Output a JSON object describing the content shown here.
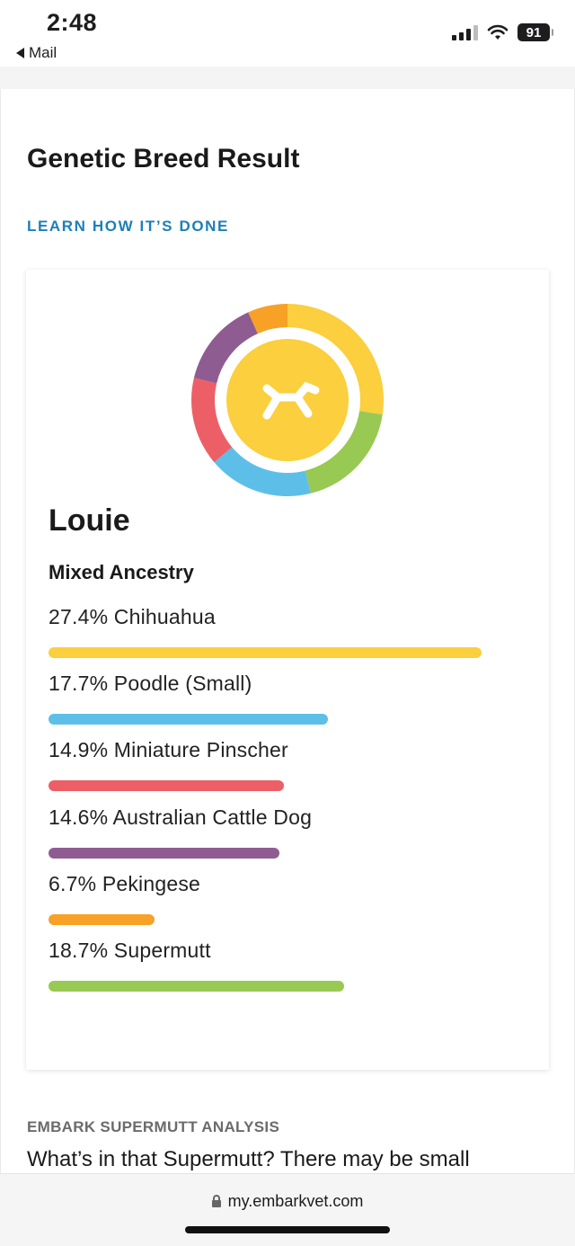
{
  "status": {
    "time": "2:48",
    "back_app": "Mail",
    "battery": "91"
  },
  "page": {
    "title": "Genetic Breed Result",
    "learn_link": "LEARN HOW IT’S DONE"
  },
  "result": {
    "dog_name": "Louie",
    "ancestry_label": "Mixed Ancestry",
    "logo_icon": "embark-dog-logo-icon",
    "breeds": [
      {
        "label": "27.4% Chihuahua",
        "percent": 27.4,
        "color": "#fbcf3d"
      },
      {
        "label": "17.7% Poodle (Small)",
        "percent": 17.7,
        "color": "#5dbfe8"
      },
      {
        "label": "14.9% Miniature Pinscher",
        "percent": 14.9,
        "color": "#ed5f66"
      },
      {
        "label": "14.6% Australian Cattle Dog",
        "percent": 14.6,
        "color": "#8f5c92"
      },
      {
        "label": "6.7% Pekingese",
        "percent": 6.7,
        "color": "#f7a126"
      },
      {
        "label": "18.7% Supermutt",
        "percent": 18.7,
        "color": "#98c952"
      }
    ]
  },
  "analysis": {
    "section_label": "EMBARK SUPERMUTT ANALYSIS",
    "teaser": "What’s in that Supermutt? There may be small"
  },
  "browser": {
    "url": "my.embarkvet.com"
  }
}
